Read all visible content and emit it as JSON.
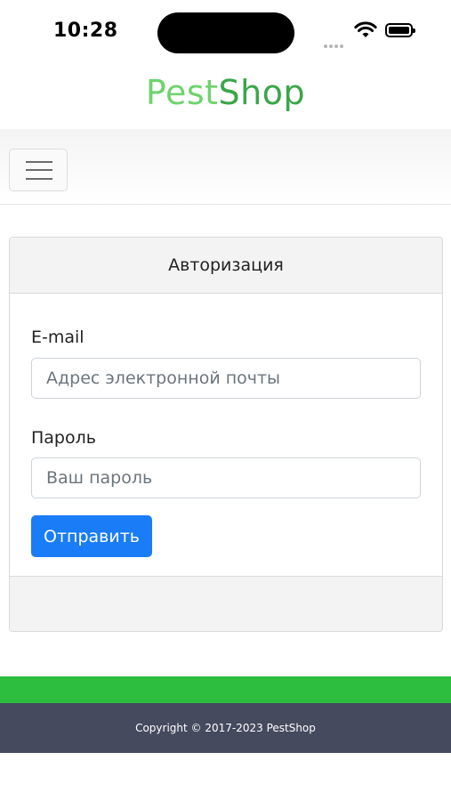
{
  "status_bar": {
    "time": "10:28",
    "icons": [
      "signal-dots-icon",
      "wifi-icon",
      "battery-icon"
    ]
  },
  "header": {
    "logo_part1": "Pest",
    "logo_part2": "Shop"
  },
  "navbar": {
    "menu_icon": "hamburger-menu-icon"
  },
  "login_card": {
    "title": "Авторизация",
    "email_label": "E-mail",
    "email_placeholder": "Адрес электронной почты",
    "email_value": "",
    "password_label": "Пароль",
    "password_placeholder": "Ваш пароль",
    "password_value": "",
    "submit_label": "Отправить"
  },
  "footer": {
    "copyright": "Copyright © 2017-2023 PestShop"
  },
  "colors": {
    "logo_light": "#6ed36e",
    "logo_dark": "#3aa64a",
    "button": "#1a7cf6",
    "green_bar": "#2dbe3f",
    "footer_bg": "#464a5f"
  }
}
